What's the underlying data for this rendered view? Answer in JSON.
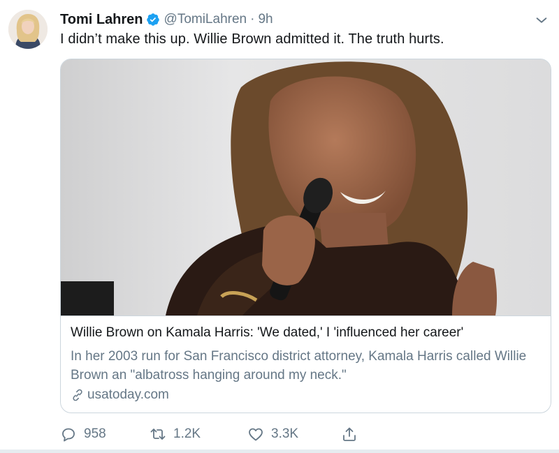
{
  "tweet": {
    "author_name": "Tomi Lahren",
    "handle": "@TomiLahren",
    "separator": "·",
    "time": "9h",
    "text": "I didn’t make this up. Willie Brown admitted it. The truth hurts."
  },
  "card": {
    "title": "Willie Brown on Kamala Harris: 'We dated,' I 'influenced her career'",
    "description": "In her 2003 run for San Francisco district attorney, Kamala Harris called Willie Brown an \"albatross hanging around my neck.\"",
    "domain": "usatoday.com",
    "image_alt": "Woman speaking into a microphone"
  },
  "actions": {
    "replies": "958",
    "retweets": "1.2K",
    "likes": "3.3K"
  },
  "icons": {
    "verified": "verified-badge-icon",
    "caret": "chevron-down-icon",
    "link": "link-icon",
    "reply": "reply-icon",
    "retweet": "retweet-icon",
    "like": "heart-icon",
    "share": "share-icon"
  },
  "colors": {
    "primary_text": "#14171a",
    "secondary_text": "#657786",
    "verified_blue": "#1da1f2",
    "border": "#ccd6dd"
  }
}
